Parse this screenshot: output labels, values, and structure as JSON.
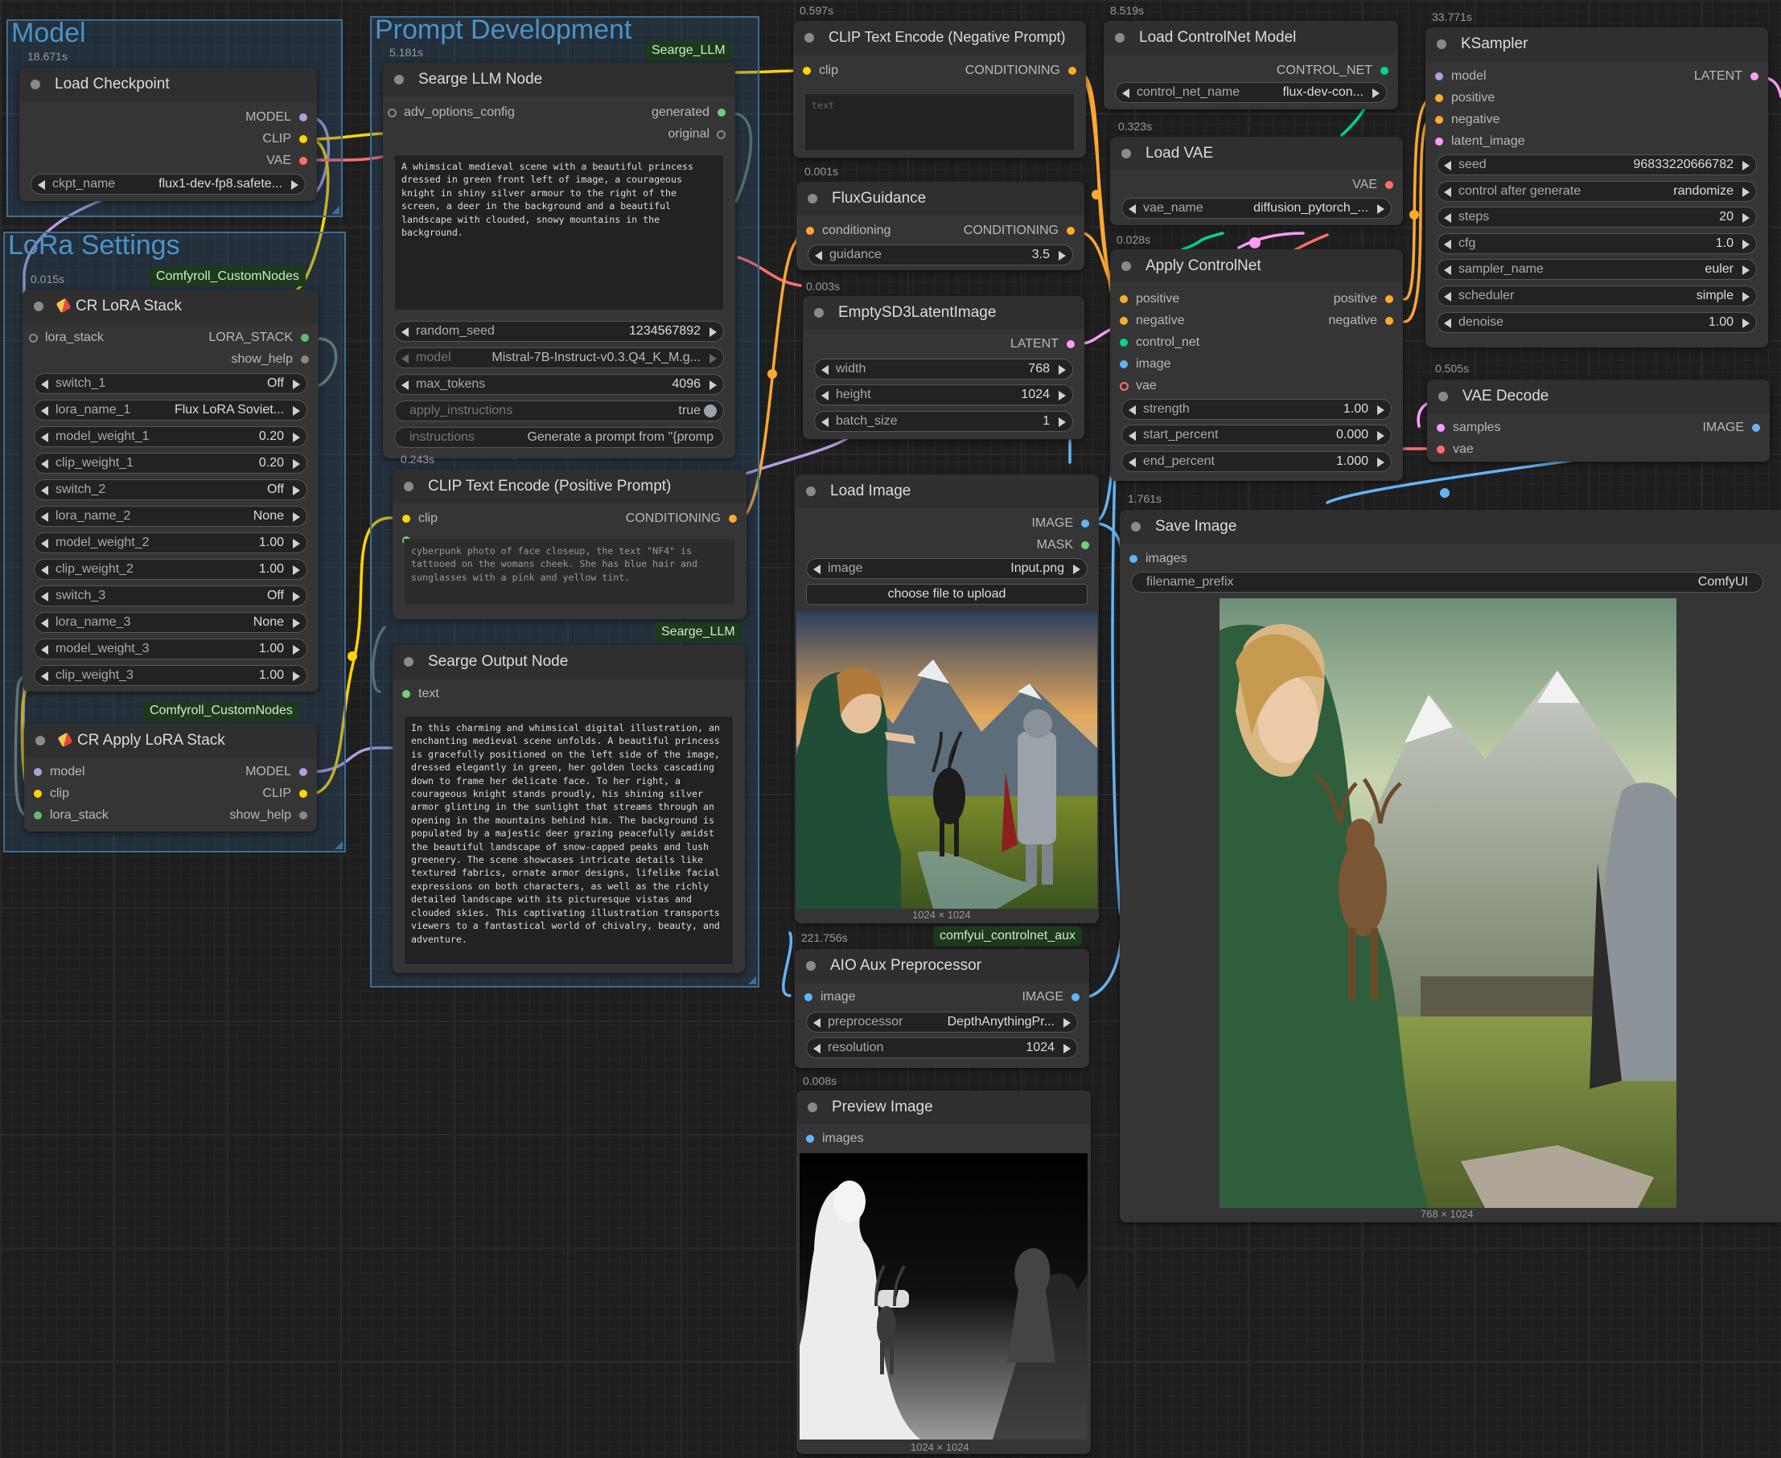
{
  "colors": {
    "model": "#b39ddb",
    "clip": "#ffd500",
    "vae": "#ff6e6e",
    "conditioning": "#ffa931",
    "latent": "#ff9cf9",
    "image": "#64b5f6",
    "lora": "#66bb6a",
    "control_net": "#00d78d",
    "string": "#77cc77",
    "none": "#888888"
  },
  "groups": {
    "model": "Model",
    "lora": "LoRa Settings",
    "prompt": "Prompt Development"
  },
  "nodes": {
    "load_checkpoint": {
      "time": "18.671s",
      "title": "Load Checkpoint",
      "outputs": [
        "MODEL",
        "CLIP",
        "VAE"
      ],
      "widgets": [
        {
          "label": "ckpt_name",
          "value": "flux1-dev-fp8.safete..."
        }
      ]
    },
    "cr_lora_stack": {
      "time": "0.015s",
      "badge": "Comfyroll_CustomNodes",
      "title": "CR LoRA Stack",
      "inputs": [
        "lora_stack"
      ],
      "outputs": [
        "LORA_STACK",
        "show_help"
      ],
      "widgets": [
        {
          "label": "switch_1",
          "value": "Off"
        },
        {
          "label": "lora_name_1",
          "value": "Flux LoRA Soviet..."
        },
        {
          "label": "model_weight_1",
          "value": "0.20"
        },
        {
          "label": "clip_weight_1",
          "value": "0.20"
        },
        {
          "label": "switch_2",
          "value": "Off"
        },
        {
          "label": "lora_name_2",
          "value": "None"
        },
        {
          "label": "model_weight_2",
          "value": "1.00"
        },
        {
          "label": "clip_weight_2",
          "value": "1.00"
        },
        {
          "label": "switch_3",
          "value": "Off"
        },
        {
          "label": "lora_name_3",
          "value": "None"
        },
        {
          "label": "model_weight_3",
          "value": "1.00"
        },
        {
          "label": "clip_weight_3",
          "value": "1.00"
        }
      ]
    },
    "cr_apply_lora_stack": {
      "badge": "Comfyroll_CustomNodes",
      "title": "CR Apply LoRA Stack",
      "inputs": [
        "model",
        "clip",
        "lora_stack"
      ],
      "outputs": [
        "MODEL",
        "CLIP",
        "show_help"
      ]
    },
    "searge_llm": {
      "time": "5.181s",
      "badge": "Searge_LLM",
      "title": "Searge LLM Node",
      "inputs": [
        "adv_options_config"
      ],
      "outputs": [
        "generated",
        "original"
      ],
      "prompt": "A whimsical medieval scene with a beautiful princess dressed in green front left of image, a courageous knight in shiny silver armour to the right of the screen, a deer in the background and a beautiful landscape with clouded, snowy mountains in the background.",
      "widgets": [
        {
          "label": "random_seed",
          "value": "1234567892"
        },
        {
          "label": "model",
          "value": "Mistral-7B-Instruct-v0.3.Q4_K_M.g..."
        },
        {
          "label": "max_tokens",
          "value": "4096"
        },
        {
          "label": "apply_instructions",
          "value": "true"
        },
        {
          "label": "instructions",
          "value": "Generate a prompt from \"{promp"
        }
      ]
    },
    "clip_positive": {
      "time": "0.243s",
      "title": "CLIP Text Encode (Positive Prompt)",
      "inputs": [
        "clip",
        ""
      ],
      "outputs": [
        "CONDITIONING"
      ],
      "text": "cyberpunk photo of face closeup, the text \"NF4\" is tattooed on the womans cheek. She has blue hair and sunglasses with a pink and yellow tint."
    },
    "searge_output": {
      "badge": "Searge_LLM",
      "title": "Searge Output Node",
      "inputs": [
        "text"
      ],
      "text": "In this charming and whimsical digital illustration, an enchanting medieval scene unfolds. A beautiful princess is gracefully positioned on the left side of the image, dressed elegantly in green, her golden locks cascading down to frame her delicate face. To her right, a courageous knight stands proudly, his shining silver armor glinting in the sunlight that streams through an opening in the mountains behind him. The background is populated by a majestic deer grazing peacefully amidst the beautiful landscape of snow-capped peaks and lush greenery. The scene showcases intricate details like textured fabrics, ornate armor designs, lifelike facial expressions on both characters, as well as the richly detailed landscape with its picturesque vistas and clouded skies. This captivating illustration transports viewers to a fantastical world of chivalry, beauty, and adventure."
    },
    "clip_negative": {
      "time": "0.597s",
      "title": "CLIP Text Encode (Negative Prompt)",
      "inputs": [
        "clip"
      ],
      "outputs": [
        "CONDITIONING"
      ],
      "placeholder": "text"
    },
    "flux_guidance": {
      "time": "0.001s",
      "title": "FluxGuidance",
      "inputs": [
        "conditioning"
      ],
      "outputs": [
        "CONDITIONING"
      ],
      "widgets": [
        {
          "label": "guidance",
          "value": "3.5"
        }
      ]
    },
    "empty_latent": {
      "time": "0.003s",
      "title": "EmptySD3LatentImage",
      "outputs": [
        "LATENT"
      ],
      "widgets": [
        {
          "label": "width",
          "value": "768"
        },
        {
          "label": "height",
          "value": "1024"
        },
        {
          "label": "batch_size",
          "value": "1"
        }
      ]
    },
    "load_image": {
      "title": "Load Image",
      "outputs": [
        "IMAGE",
        "MASK"
      ],
      "widgets": [
        {
          "label": "image",
          "value": "Input.png"
        }
      ],
      "upload_label": "choose file to upload",
      "caption": "1024 × 1024"
    },
    "aio_aux": {
      "time": "221.756s",
      "badge": "comfyui_controlnet_aux",
      "title": "AIO Aux Preprocessor",
      "inputs": [
        "image"
      ],
      "outputs": [
        "IMAGE"
      ],
      "widgets": [
        {
          "label": "preprocessor",
          "value": "DepthAnythingPr..."
        },
        {
          "label": "resolution",
          "value": "1024"
        }
      ]
    },
    "preview_image": {
      "time": "0.008s",
      "title": "Preview Image",
      "inputs": [
        "images"
      ],
      "caption": "1024 × 1024"
    },
    "load_controlnet": {
      "time": "8.519s",
      "title": "Load ControlNet Model",
      "outputs": [
        "CONTROL_NET"
      ],
      "widgets": [
        {
          "label": "control_net_name",
          "value": "flux-dev-con..."
        }
      ]
    },
    "load_vae": {
      "time": "0.323s",
      "title": "Load VAE",
      "outputs": [
        "VAE"
      ],
      "widgets": [
        {
          "label": "vae_name",
          "value": "diffusion_pytorch_..."
        }
      ]
    },
    "apply_controlnet": {
      "time": "0.028s",
      "title": "Apply ControlNet",
      "inputs": [
        "positive",
        "negative",
        "control_net",
        "image",
        "vae"
      ],
      "outputs": [
        "positive",
        "negative"
      ],
      "widgets": [
        {
          "label": "strength",
          "value": "1.00"
        },
        {
          "label": "start_percent",
          "value": "0.000"
        },
        {
          "label": "end_percent",
          "value": "1.000"
        }
      ]
    },
    "ksampler": {
      "time": "33.771s",
      "title": "KSampler",
      "inputs": [
        "model",
        "positive",
        "negative",
        "latent_image"
      ],
      "outputs": [
        "LATENT"
      ],
      "widgets": [
        {
          "label": "seed",
          "value": "96833220666782"
        },
        {
          "label": "control after generate",
          "value": "randomize"
        },
        {
          "label": "steps",
          "value": "20"
        },
        {
          "label": "cfg",
          "value": "1.0"
        },
        {
          "label": "sampler_name",
          "value": "euler"
        },
        {
          "label": "scheduler",
          "value": "simple"
        },
        {
          "label": "denoise",
          "value": "1.00"
        }
      ]
    },
    "vae_decode": {
      "time": "0.505s",
      "title": "VAE Decode",
      "inputs": [
        "samples",
        "vae"
      ],
      "outputs": [
        "IMAGE"
      ]
    },
    "save_image": {
      "time": "1.761s",
      "title": "Save Image",
      "inputs": [
        "images"
      ],
      "widgets": [
        {
          "label": "filename_prefix",
          "value": "ComfyUI"
        }
      ],
      "caption": "768 × 1024"
    }
  }
}
